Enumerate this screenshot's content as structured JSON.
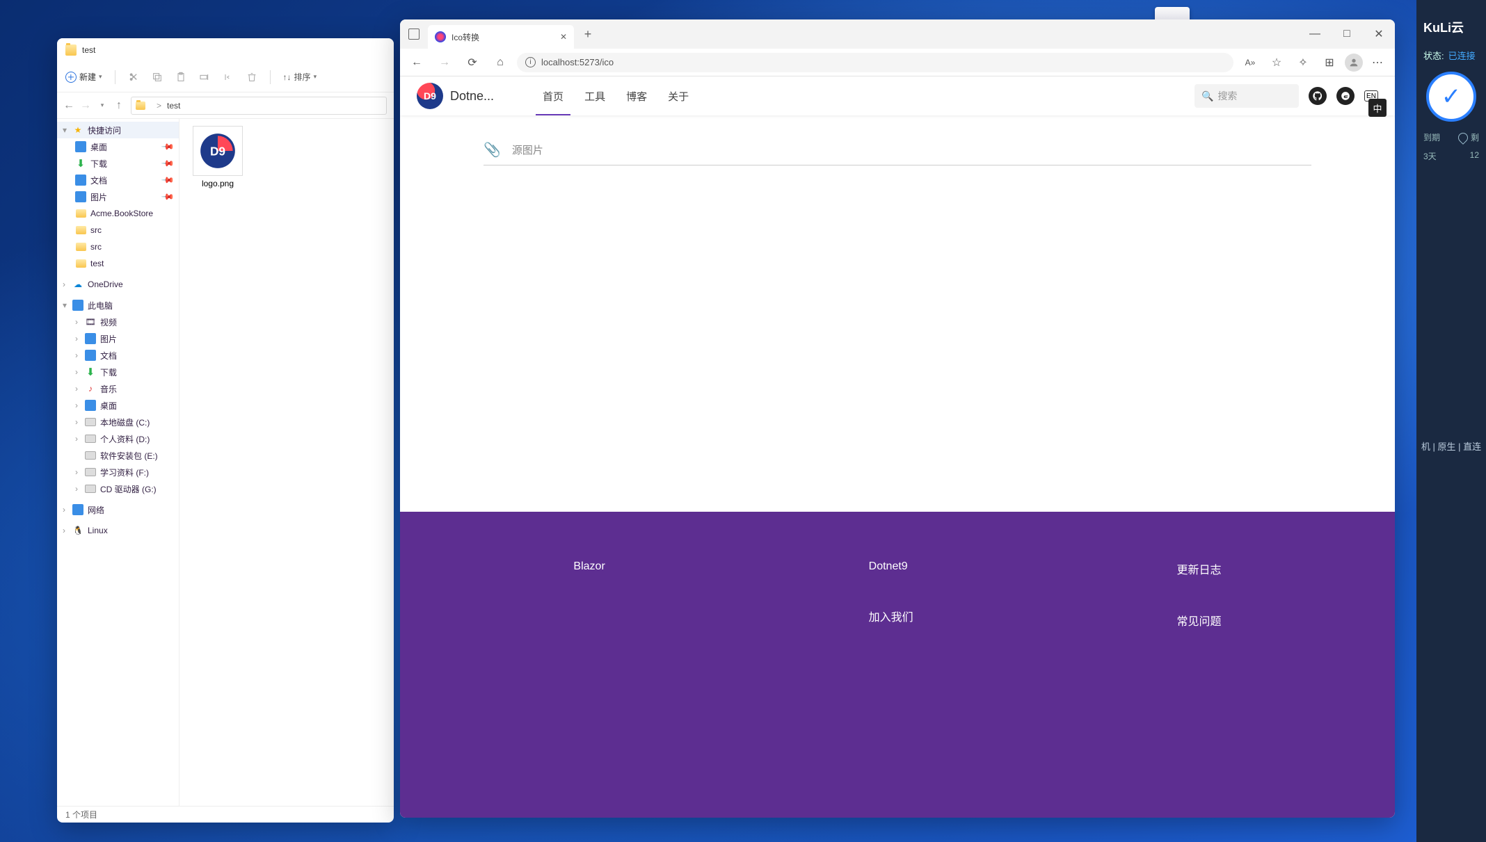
{
  "explorer": {
    "title": "test",
    "toolbar": {
      "new": "新建",
      "sort": "排序"
    },
    "breadcrumb": {
      "sep": ">",
      "current": "test"
    },
    "side": {
      "quick": "快捷访问",
      "items_pinned": [
        "桌面",
        "下载",
        "文档",
        "图片"
      ],
      "items_plain": [
        "Acme.BookStore",
        "src",
        "src",
        "test"
      ],
      "onedrive": "OneDrive",
      "thispc": "此电脑",
      "pc_items": [
        "视频",
        "图片",
        "文档",
        "下载",
        "音乐",
        "桌面",
        "本地磁盘 (C:)",
        "个人资料 (D:)",
        "软件安装包 (E:)",
        "学习资料 (F:)",
        "CD 驱动器 (G:)"
      ],
      "network": "网络",
      "linux": "Linux"
    },
    "file": {
      "name": "logo.png"
    },
    "status": "1 个项目"
  },
  "browser": {
    "tab_title": "Ico转换",
    "url": "localhost:5273/ico",
    "controls": {
      "min": "—",
      "max": "□",
      "close": "✕"
    },
    "ime_en": "EN",
    "ime_cn": "中"
  },
  "page": {
    "brand": "Dotne...",
    "logo_text": "D9",
    "nav": [
      "首页",
      "工具",
      "博客",
      "关于"
    ],
    "search_placeholder": "搜索",
    "upload_label": "源图片",
    "footer": {
      "col1": [
        "Blazor"
      ],
      "col2": [
        "Dotnet9",
        "加入我们"
      ],
      "col3": [
        "更新日志",
        "常见问题"
      ]
    }
  },
  "overlay": {
    "title": "KuLi云",
    "status_label": "状态:",
    "status_value": "已连接",
    "expire_label": "到期",
    "expire_value": "3天",
    "rem_label": "剩",
    "rem_value": "12",
    "links": "机 | 原生 | 直连"
  }
}
